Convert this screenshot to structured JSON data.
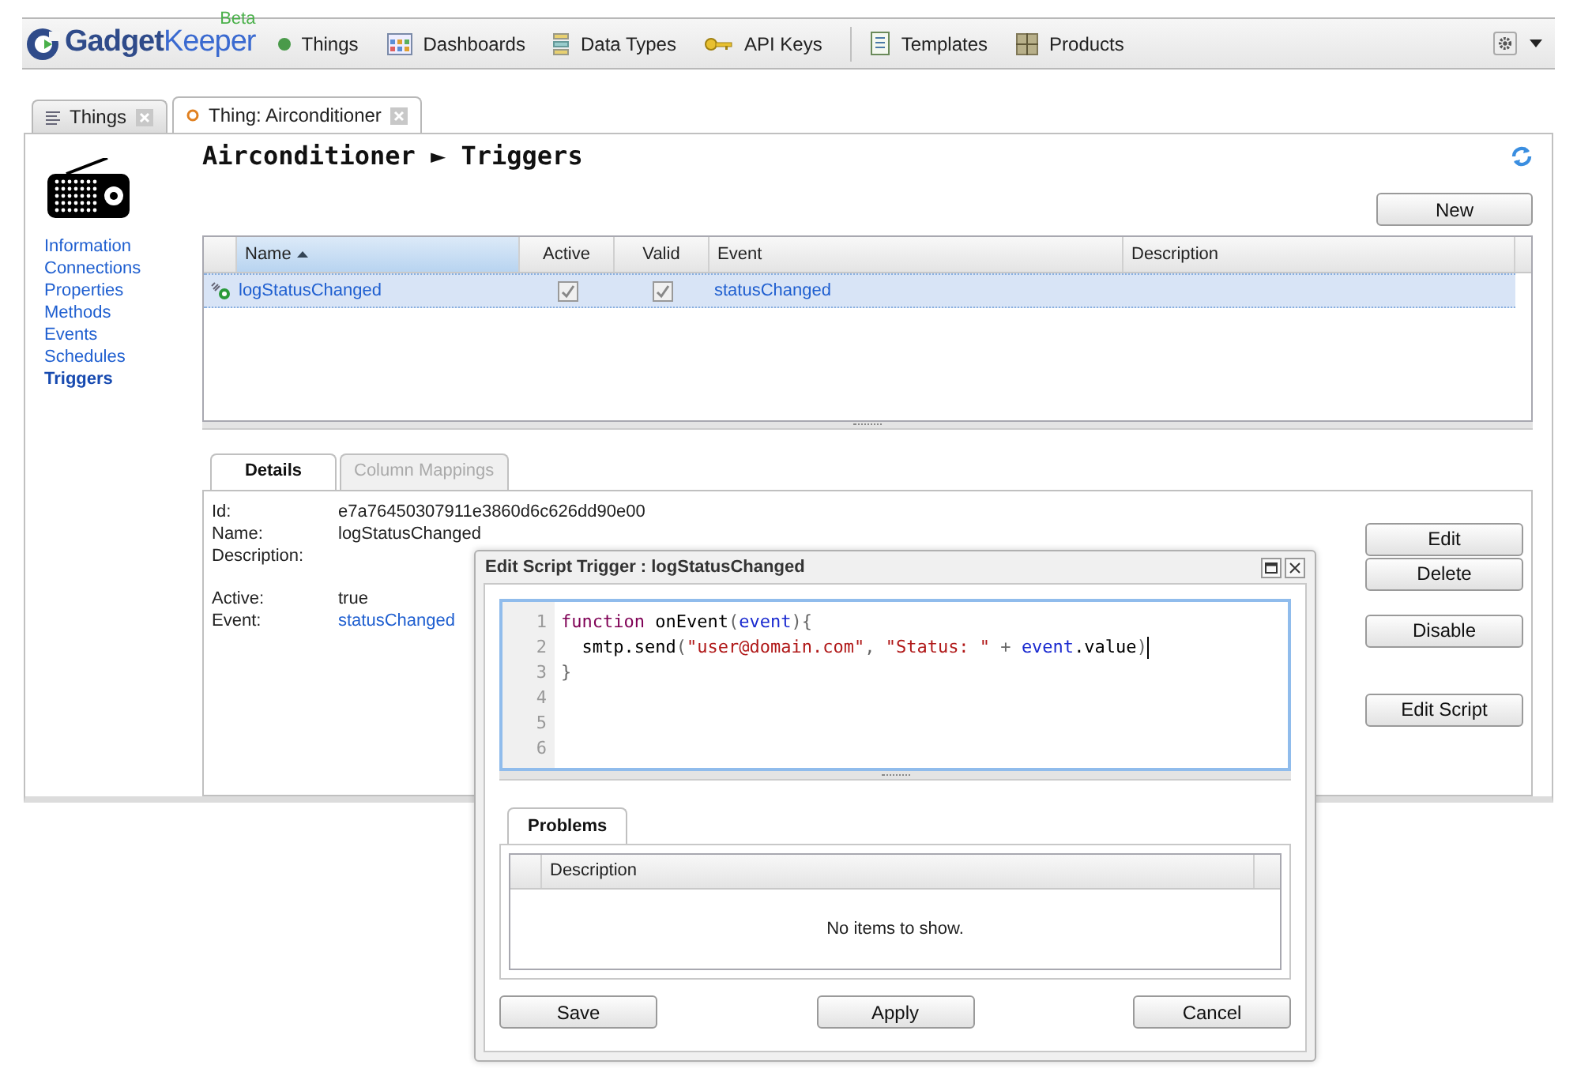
{
  "app": {
    "logo": "**Gadget**Keeper",
    "badge": "Beta"
  },
  "nav": [
    {
      "label": "Things",
      "kind": "dot"
    },
    {
      "label": "Dashboards",
      "kind": "dashboard"
    },
    {
      "label": "Data Types",
      "kind": "types"
    },
    {
      "label": "API Keys",
      "kind": "key"
    },
    {
      "label": "Templates",
      "kind": "template"
    },
    {
      "label": "Products",
      "kind": "product"
    }
  ],
  "tabs": [
    {
      "label": "Things",
      "selected": false,
      "kind": "list"
    },
    {
      "label": "Thing: Airconditioner",
      "selected": true,
      "kind": "thing"
    }
  ],
  "sidebar": {
    "items": [
      {
        "label": "Information",
        "selected": false
      },
      {
        "label": "Connections",
        "selected": false
      },
      {
        "label": "Properties",
        "selected": false
      },
      {
        "label": "Methods",
        "selected": false
      },
      {
        "label": "Events",
        "selected": false
      },
      {
        "label": "Schedules",
        "selected": false
      },
      {
        "label": "Triggers",
        "selected": true
      }
    ]
  },
  "heading": "Airconditioner ► Triggers",
  "new_button": "New",
  "table": {
    "columns": [
      "Name",
      "Active",
      "Valid",
      "Event",
      "Description"
    ],
    "rows": [
      {
        "name": "logStatusChanged",
        "active": true,
        "valid": true,
        "event": "statusChanged",
        "selected": true
      }
    ]
  },
  "detail_tabs": [
    {
      "label": "Details",
      "selected": true,
      "disabled": false
    },
    {
      "label": "Column Mappings",
      "selected": false,
      "disabled": true
    }
  ],
  "details": [
    {
      "label": "Id:",
      "value": "e7a76450307911e3860d6c626dd90e00",
      "link": false
    },
    {
      "label": "Name:",
      "value": "logStatusChanged",
      "link": false
    },
    {
      "label": "Description:"
    },
    {
      "label": "Active:",
      "value": "true",
      "link": false
    },
    {
      "label": "Event:",
      "value": "statusChanged",
      "link": true
    }
  ],
  "actions": [
    {
      "label": "Edit"
    },
    {
      "label": "Delete"
    },
    {
      "label": "Disable"
    },
    {
      "label": "Edit Script"
    }
  ],
  "dialog": {
    "title": "Edit Script Trigger : logStatusChanged",
    "code": [
      [
        {
          "text": "function",
          "kind": "keyword"
        },
        {
          "text": " onEvent",
          "kind": "plain"
        },
        {
          "text": "(",
          "kind": "punct"
        },
        {
          "text": "event",
          "kind": "var"
        },
        {
          "text": "){",
          "kind": "punct"
        }
      ],
      [
        {
          "text": "  smtp.send",
          "kind": "plain"
        },
        {
          "text": "(",
          "kind": "punct"
        },
        {
          "text": "\"user@domain.com\"",
          "kind": "string"
        },
        {
          "text": ", ",
          "kind": "punct"
        },
        {
          "text": "\"Status: \"",
          "kind": "string"
        },
        {
          "text": " + ",
          "kind": "punct"
        },
        {
          "text": "event",
          "kind": "var"
        },
        {
          "text": ".value",
          "kind": "plain"
        },
        {
          "text": ")",
          "kind": "punct"
        }
      ],
      [
        {
          "text": "}",
          "kind": "punct"
        }
      ]
    ],
    "line_numbers": [
      "1",
      "2",
      "3",
      "4",
      "5",
      "6"
    ],
    "problems_tab": "Problems",
    "problems_column": "Description",
    "empty_text": "No items to show.",
    "buttons": [
      "Save",
      "Apply",
      "Cancel"
    ]
  }
}
